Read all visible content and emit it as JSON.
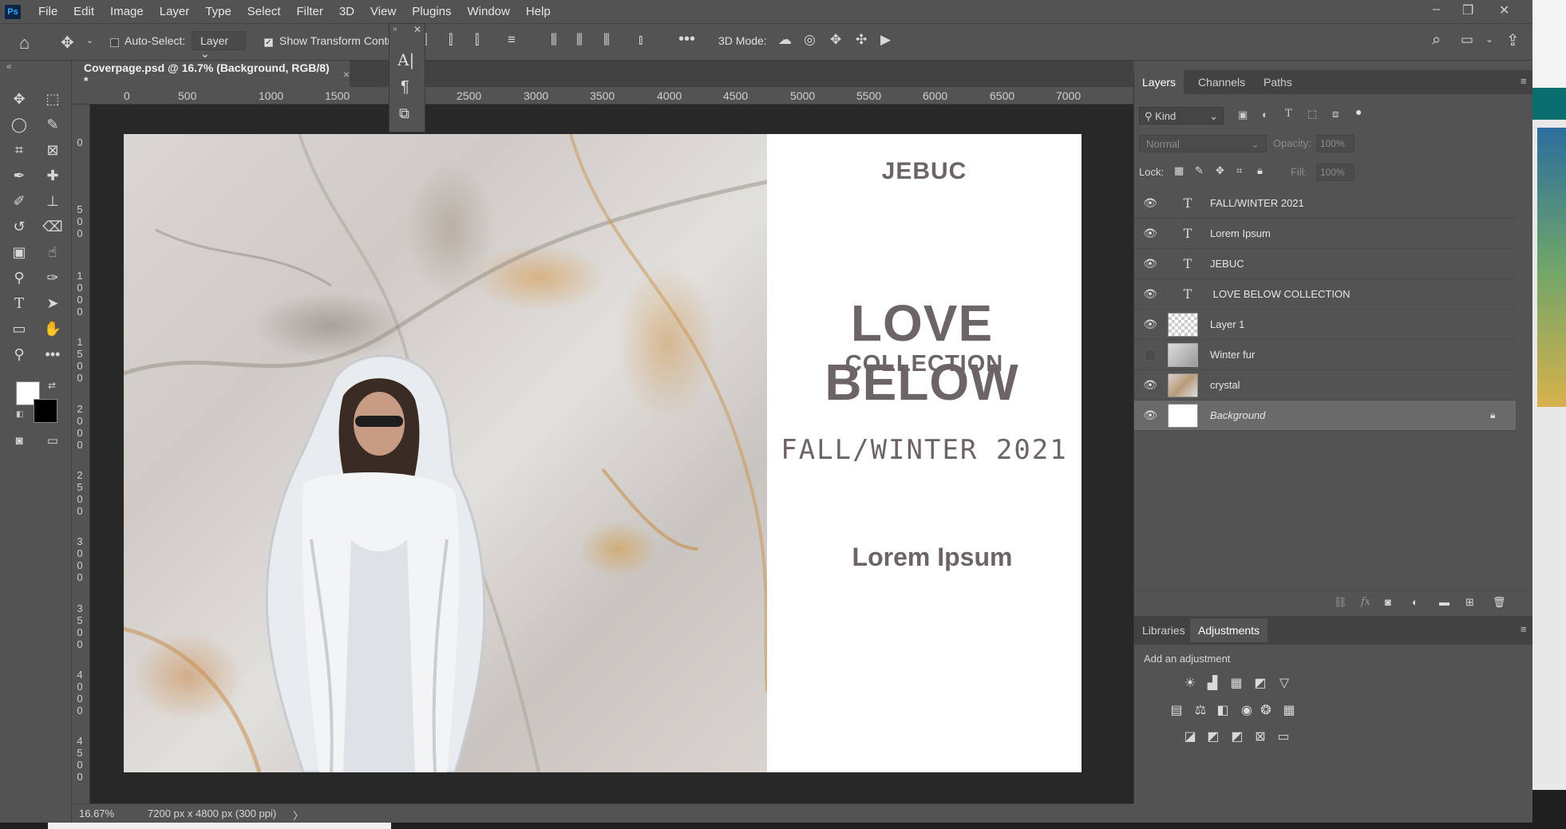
{
  "app": {
    "logo": "Ps"
  },
  "menu": [
    "File",
    "Edit",
    "Image",
    "Layer",
    "Type",
    "Select",
    "Filter",
    "3D",
    "View",
    "Plugins",
    "Window",
    "Help"
  ],
  "window_controls": {
    "minimize": "–",
    "restore": "❐",
    "close": "✕"
  },
  "options_bar": {
    "auto_select_label": "Auto-Select:",
    "auto_select_target": "Layer",
    "show_transform_label": "Show Transform Control",
    "mode_3d_label": "3D Mode:"
  },
  "document": {
    "tab_title": "Coverpage.psd @ 16.7% (Background, RGB/8) *",
    "tab_close": "×"
  },
  "ruler": {
    "h_ticks": [
      "0",
      "500",
      "1000",
      "1500",
      "2500",
      "3000",
      "3500",
      "4000",
      "4500",
      "5000",
      "5500",
      "6000",
      "6500",
      "7000"
    ],
    "v_ticks": [
      "0",
      "5\n0\n0",
      "1\n0\n0\n0",
      "1\n5\n0\n0",
      "2\n0\n0\n0",
      "2\n5\n0\n0",
      "3\n0\n0\n0",
      "3\n5\n0\n0",
      "4\n0\n0\n0",
      "4\n5\n0\n0"
    ]
  },
  "artwork": {
    "brand": "JEBUC",
    "title": "LOVE BELOW",
    "subtitle": "COLLECTION",
    "season": "FALL/WINTER 2021",
    "tagline": "Lorem Ipsum"
  },
  "status_bar": {
    "zoom": "16.67%",
    "doc_info": "7200 px x 4800 px (300 ppi)",
    "arrow": "〉"
  },
  "layers_panel": {
    "tabs": [
      "Layers",
      "Channels",
      "Paths"
    ],
    "filter_kind": "Kind",
    "blend_mode": "Normal",
    "opacity_label": "Opacity:",
    "opacity_value": "100%",
    "lock_label": "Lock:",
    "fill_label": "Fill:",
    "fill_value": "100%",
    "layers": [
      {
        "name": "FALL/WINTER 2021",
        "type": "text",
        "visible": true
      },
      {
        "name": "Lorem Ipsum",
        "type": "text",
        "visible": true
      },
      {
        "name": "JEBUC",
        "type": "text",
        "visible": true
      },
      {
        "name": " LOVE BELOW COLLECTION",
        "type": "text",
        "visible": true
      },
      {
        "name": "Layer 1",
        "type": "pixel-transparent",
        "visible": true
      },
      {
        "name": "Winter fur",
        "type": "smart",
        "visible": false
      },
      {
        "name": "crystal",
        "type": "image",
        "visible": true
      },
      {
        "name": "Background",
        "type": "background",
        "visible": true,
        "selected": true,
        "locked": true
      }
    ]
  },
  "adjustments_panel": {
    "tabs": [
      "Libraries",
      "Adjustments"
    ],
    "hint": "Add an adjustment"
  },
  "colors": {
    "ui_bg": "#535353",
    "ui_dark": "#424242",
    "canvas_bg": "#282828",
    "text_layer_color": "#6d6466",
    "ps_blue": "#31a8ff"
  }
}
